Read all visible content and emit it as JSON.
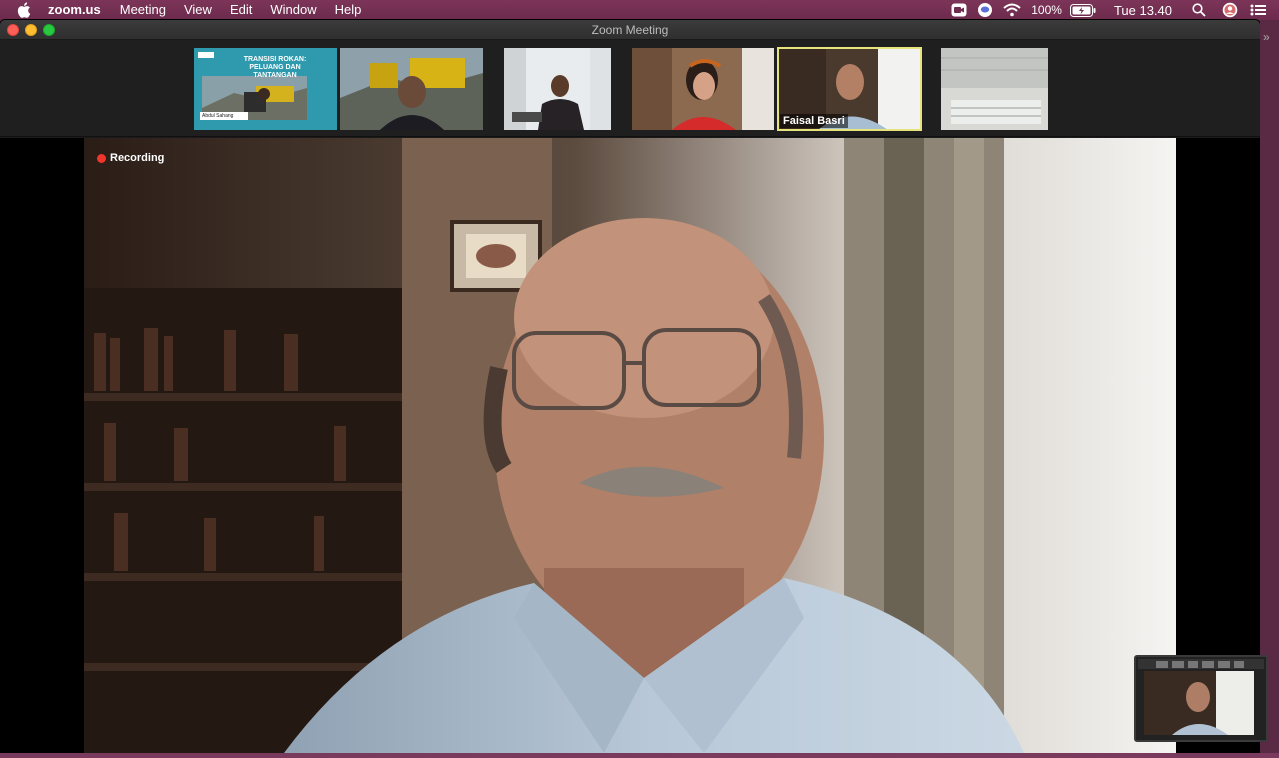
{
  "menubar": {
    "app": "zoom.us",
    "menus": [
      "Meeting",
      "View",
      "Edit",
      "Window",
      "Help"
    ],
    "battery": "100%",
    "clock": "Tue 13.40",
    "status_icons": [
      "zoom-icon",
      "messages-icon",
      "wifi-icon",
      "battery-icon",
      "spotlight-search-icon",
      "user-icon",
      "control-center-icon"
    ]
  },
  "window": {
    "title": "Zoom Meeting"
  },
  "thumbnails": [
    {
      "kind": "shared-slide",
      "slide_title": "TRANSISI ROKAN:",
      "slide_subtitle": "PELUANG DAN TANTANGAN",
      "slide_caption": "Abdul Sahang"
    },
    {
      "kind": "participant"
    },
    {
      "kind": "participant"
    },
    {
      "kind": "participant"
    },
    {
      "kind": "participant",
      "name": "Faisal Basri",
      "active": true
    },
    {
      "kind": "participant"
    }
  ],
  "main": {
    "recording_label": "Recording"
  },
  "colors": {
    "desktop": "#6e2c4f",
    "active_speaker": "#e7e37d",
    "recording": "#f0352d"
  }
}
